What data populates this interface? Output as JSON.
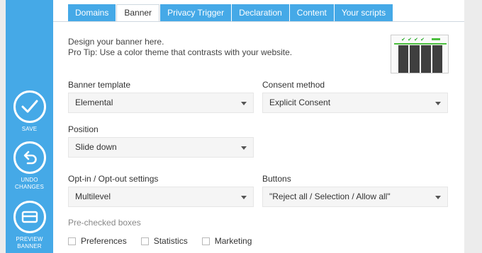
{
  "sidebar": {
    "save_label": "SAVE",
    "undo_label_1": "UNDO",
    "undo_label_2": "CHANGES",
    "preview_label_1": "PREVIEW",
    "preview_label_2": "BANNER"
  },
  "tabs": [
    "Domains",
    "Banner",
    "Privacy Trigger",
    "Declaration",
    "Content",
    "Your scripts"
  ],
  "active_tab": "Banner",
  "intro": {
    "line1": "Design your banner here.",
    "line2": "Pro Tip: Use a color theme that contrasts with your website."
  },
  "fields": {
    "banner_template": {
      "label": "Banner template",
      "value": "Elemental"
    },
    "consent_method": {
      "label": "Consent method",
      "value": "Explicit Consent"
    },
    "position": {
      "label": "Position",
      "value": "Slide down"
    },
    "optin": {
      "label": "Opt-in / Opt-out settings",
      "value": "Multilevel"
    },
    "buttons": {
      "label": "Buttons",
      "value": "\"Reject all / Selection / Allow all\""
    }
  },
  "prechecked": {
    "label": "Pre-checked boxes",
    "items": [
      "Preferences",
      "Statistics",
      "Marketing"
    ]
  },
  "colors": {
    "accent": "#45a9e7",
    "thumb_green": "#4dbf3f",
    "thumb_dark": "#3f3f3f"
  },
  "icons": [
    "check-icon",
    "undo-icon",
    "preview-icon"
  ]
}
